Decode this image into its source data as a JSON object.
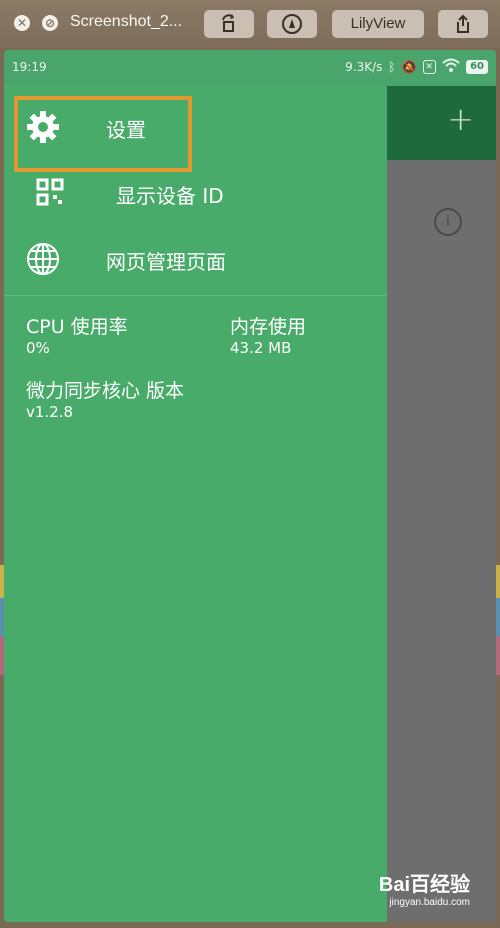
{
  "window": {
    "title": "Screenshot_2...",
    "lilyview_label": "LilyView"
  },
  "status_bar": {
    "time": "19:19",
    "speed": "9.3K/s",
    "battery": "60"
  },
  "drawer": {
    "items": [
      {
        "label": "设置",
        "icon": "gear-icon"
      },
      {
        "label": "显示设备 ID",
        "icon": "qr-code-icon"
      },
      {
        "label": "网页管理页面",
        "icon": "globe-icon"
      }
    ],
    "stats": {
      "cpu_label": "CPU 使用率",
      "cpu_value": "0%",
      "memory_label": "内存使用",
      "memory_value": "43.2 MB",
      "version_label": "微力同步核心 版本",
      "version_value": "v1.2.8"
    }
  },
  "background_app": {
    "add_icon": "plus-icon",
    "info_icon": "info-icon"
  },
  "watermark": {
    "main": "Bai百经验",
    "sub": "jingyan.baidu.com"
  },
  "colors": {
    "drawer": "#48ab6a",
    "appbar": "#1f6a3d",
    "highlight": "#e3982f"
  }
}
